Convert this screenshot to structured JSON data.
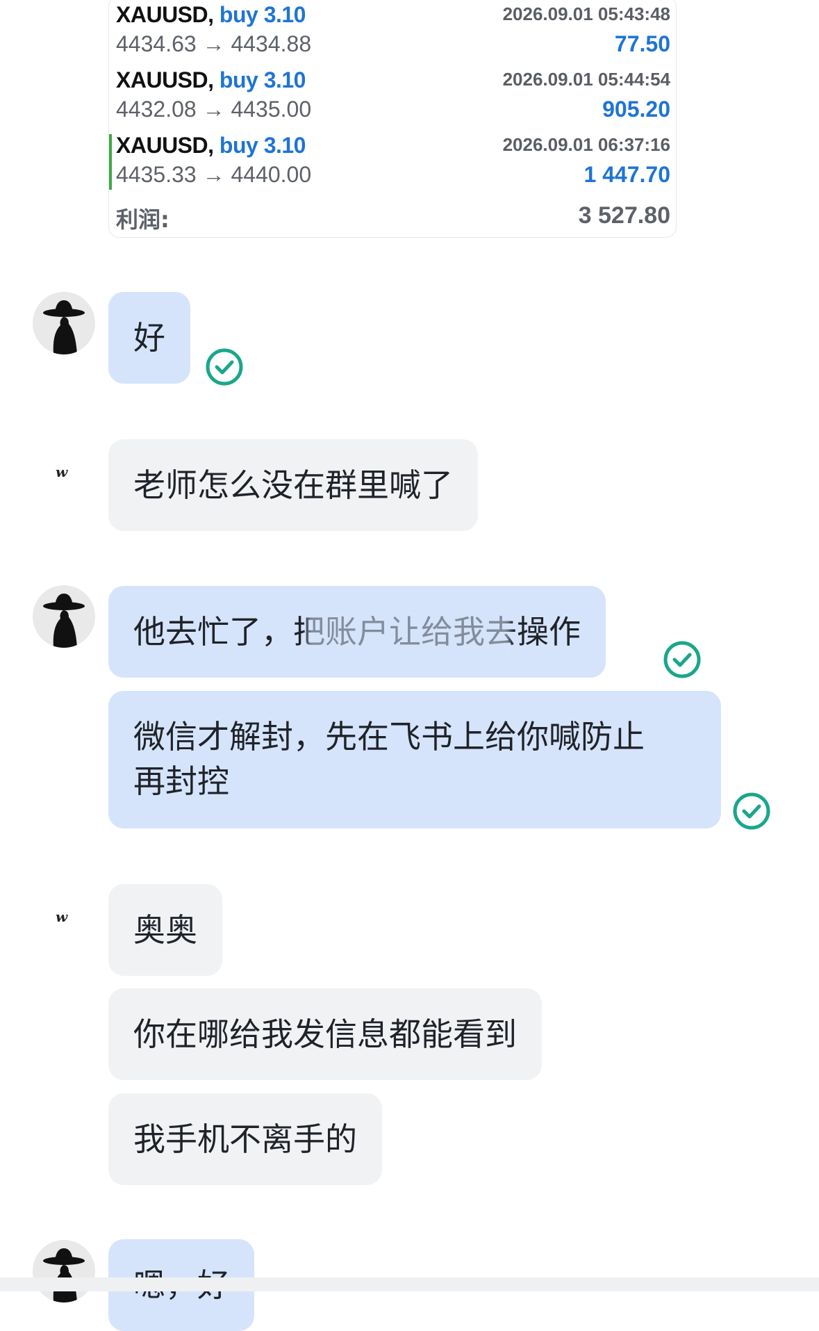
{
  "trades": [
    {
      "symbol": "XAUUSD,",
      "direction": "buy 3.10",
      "time": "2026.09.01 05:43:48",
      "prices": "4434.63 → 4434.88",
      "profit": "77.50"
    },
    {
      "symbol": "XAUUSD,",
      "direction": "buy 3.10",
      "time": "2026.09.01 05:44:54",
      "prices": "4432.08 → 4435.00",
      "profit": "905.20"
    },
    {
      "symbol": "XAUUSD,",
      "direction": "buy 3.10",
      "time": "2026.09.01 06:37:16",
      "prices": "4435.33 → 4440.00",
      "profit": "1 447.70"
    }
  ],
  "total": {
    "label": "利润:",
    "value": "3 527.80"
  },
  "messages": [
    {
      "sender": "me",
      "text": "好"
    },
    {
      "sender": "other",
      "text": "老师怎么没在群里喊了"
    },
    {
      "sender": "me",
      "text": "他去忙了，把账户让给我去操作"
    },
    {
      "sender": "me",
      "text_lines": [
        "微信才解封，先在飞书上给你喊防止",
        "再封控"
      ]
    },
    {
      "sender": "other",
      "text": "奥奥"
    },
    {
      "sender": "other",
      "text": "你在哪给我发信息都能看到"
    },
    {
      "sender": "other",
      "text": "我手机不离手的"
    },
    {
      "sender": "me",
      "text": "嗯，好"
    }
  ],
  "other_avatar_text": "w",
  "colors": {
    "accent": "#1e74d6",
    "my_bubble": "#d6e4fb",
    "their_bubble": "#f1f2f4",
    "read_check": "#1aa68a",
    "active_marker": "#3fa845"
  },
  "icons": {
    "read": "check-circle-icon",
    "avatar": "hat-silhouette-avatar"
  }
}
